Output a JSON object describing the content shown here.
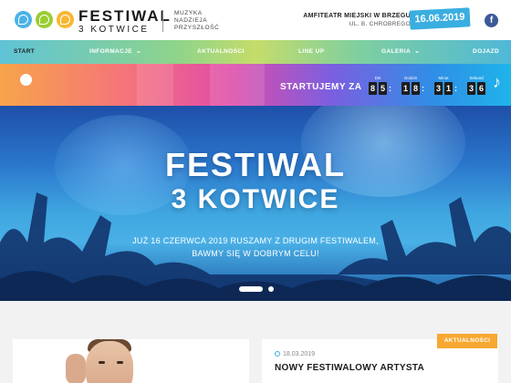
{
  "header": {
    "brand_top": "FESTIWAL",
    "brand_bottom": "3 KOTWICE",
    "tagline": [
      "MUZYKA",
      "NADZIEJA",
      "PRZYSZŁOŚĆ"
    ],
    "venue_name": "AMFITEATR MIEJSKI W BRZEGU",
    "venue_address": "UL. B. CHROBREGO",
    "date": "16.06.2019",
    "facebook": "f"
  },
  "nav": {
    "items": [
      {
        "label": "START",
        "active": true
      },
      {
        "label": "INFORMACJE",
        "dropdown": true
      },
      {
        "label": "AKTUALNOŚCI"
      },
      {
        "label": "LINE UP"
      },
      {
        "label": "GALERIA",
        "dropdown": true
      },
      {
        "label": "DOJAZD"
      }
    ]
  },
  "countdown": {
    "label": "STARTUJEMY ZA",
    "units": [
      {
        "label": "Dni",
        "digits": [
          "8",
          "5"
        ]
      },
      {
        "label": "Godzin",
        "digits": [
          "1",
          "8"
        ]
      },
      {
        "label": "Minut",
        "digits": [
          "3",
          "1"
        ]
      },
      {
        "label": "Sekund",
        "digits": [
          "3",
          "6"
        ]
      }
    ]
  },
  "hero": {
    "title_line1": "FESTIWAL",
    "title_line2": "3 KOTWICE",
    "subtitle_line1": "JUŻ 16 CZERWCA 2019 RUSZAMY Z DRUGIM FESTIWALEM,",
    "subtitle_line2": "BAWMY SIĘ W DOBRYM CELU!"
  },
  "news": {
    "category": "AKTUALNOŚCI",
    "date": "18.03.2019",
    "title": "NOWY FESTIWALOWY ARTYSTA"
  },
  "colors": {
    "accent_blue": "#3aaee0",
    "badge_orange": "#f7a830",
    "facebook": "#3b5998"
  }
}
